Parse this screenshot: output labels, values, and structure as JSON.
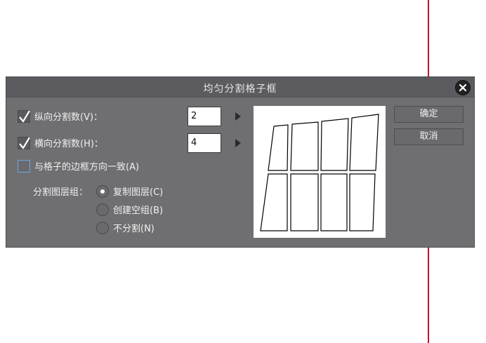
{
  "dialog": {
    "title": "均匀分割格子框",
    "close_icon": "close-icon"
  },
  "vertical": {
    "label": "纵向分割数(V)：",
    "checked": true,
    "value": "2"
  },
  "horizontal": {
    "label": "横向分割数(H)：",
    "checked": true,
    "value": "4"
  },
  "align_border": {
    "label": "与格子的边框方向一致(A)",
    "checked": false
  },
  "layer_group": {
    "label": "分割图层组：",
    "options": [
      {
        "label": "复制图层(C)",
        "selected": true
      },
      {
        "label": "创建空组(B)",
        "selected": false
      },
      {
        "label": "不分割(N)",
        "selected": false
      }
    ]
  },
  "buttons": {
    "ok": "确定",
    "cancel": "取消"
  },
  "colors": {
    "dialog_bg": "#6f6f72",
    "titlebar_bg": "#5c5c60",
    "guide_line": "#c8102e",
    "checkbox_focus": "#6fa7d8"
  }
}
